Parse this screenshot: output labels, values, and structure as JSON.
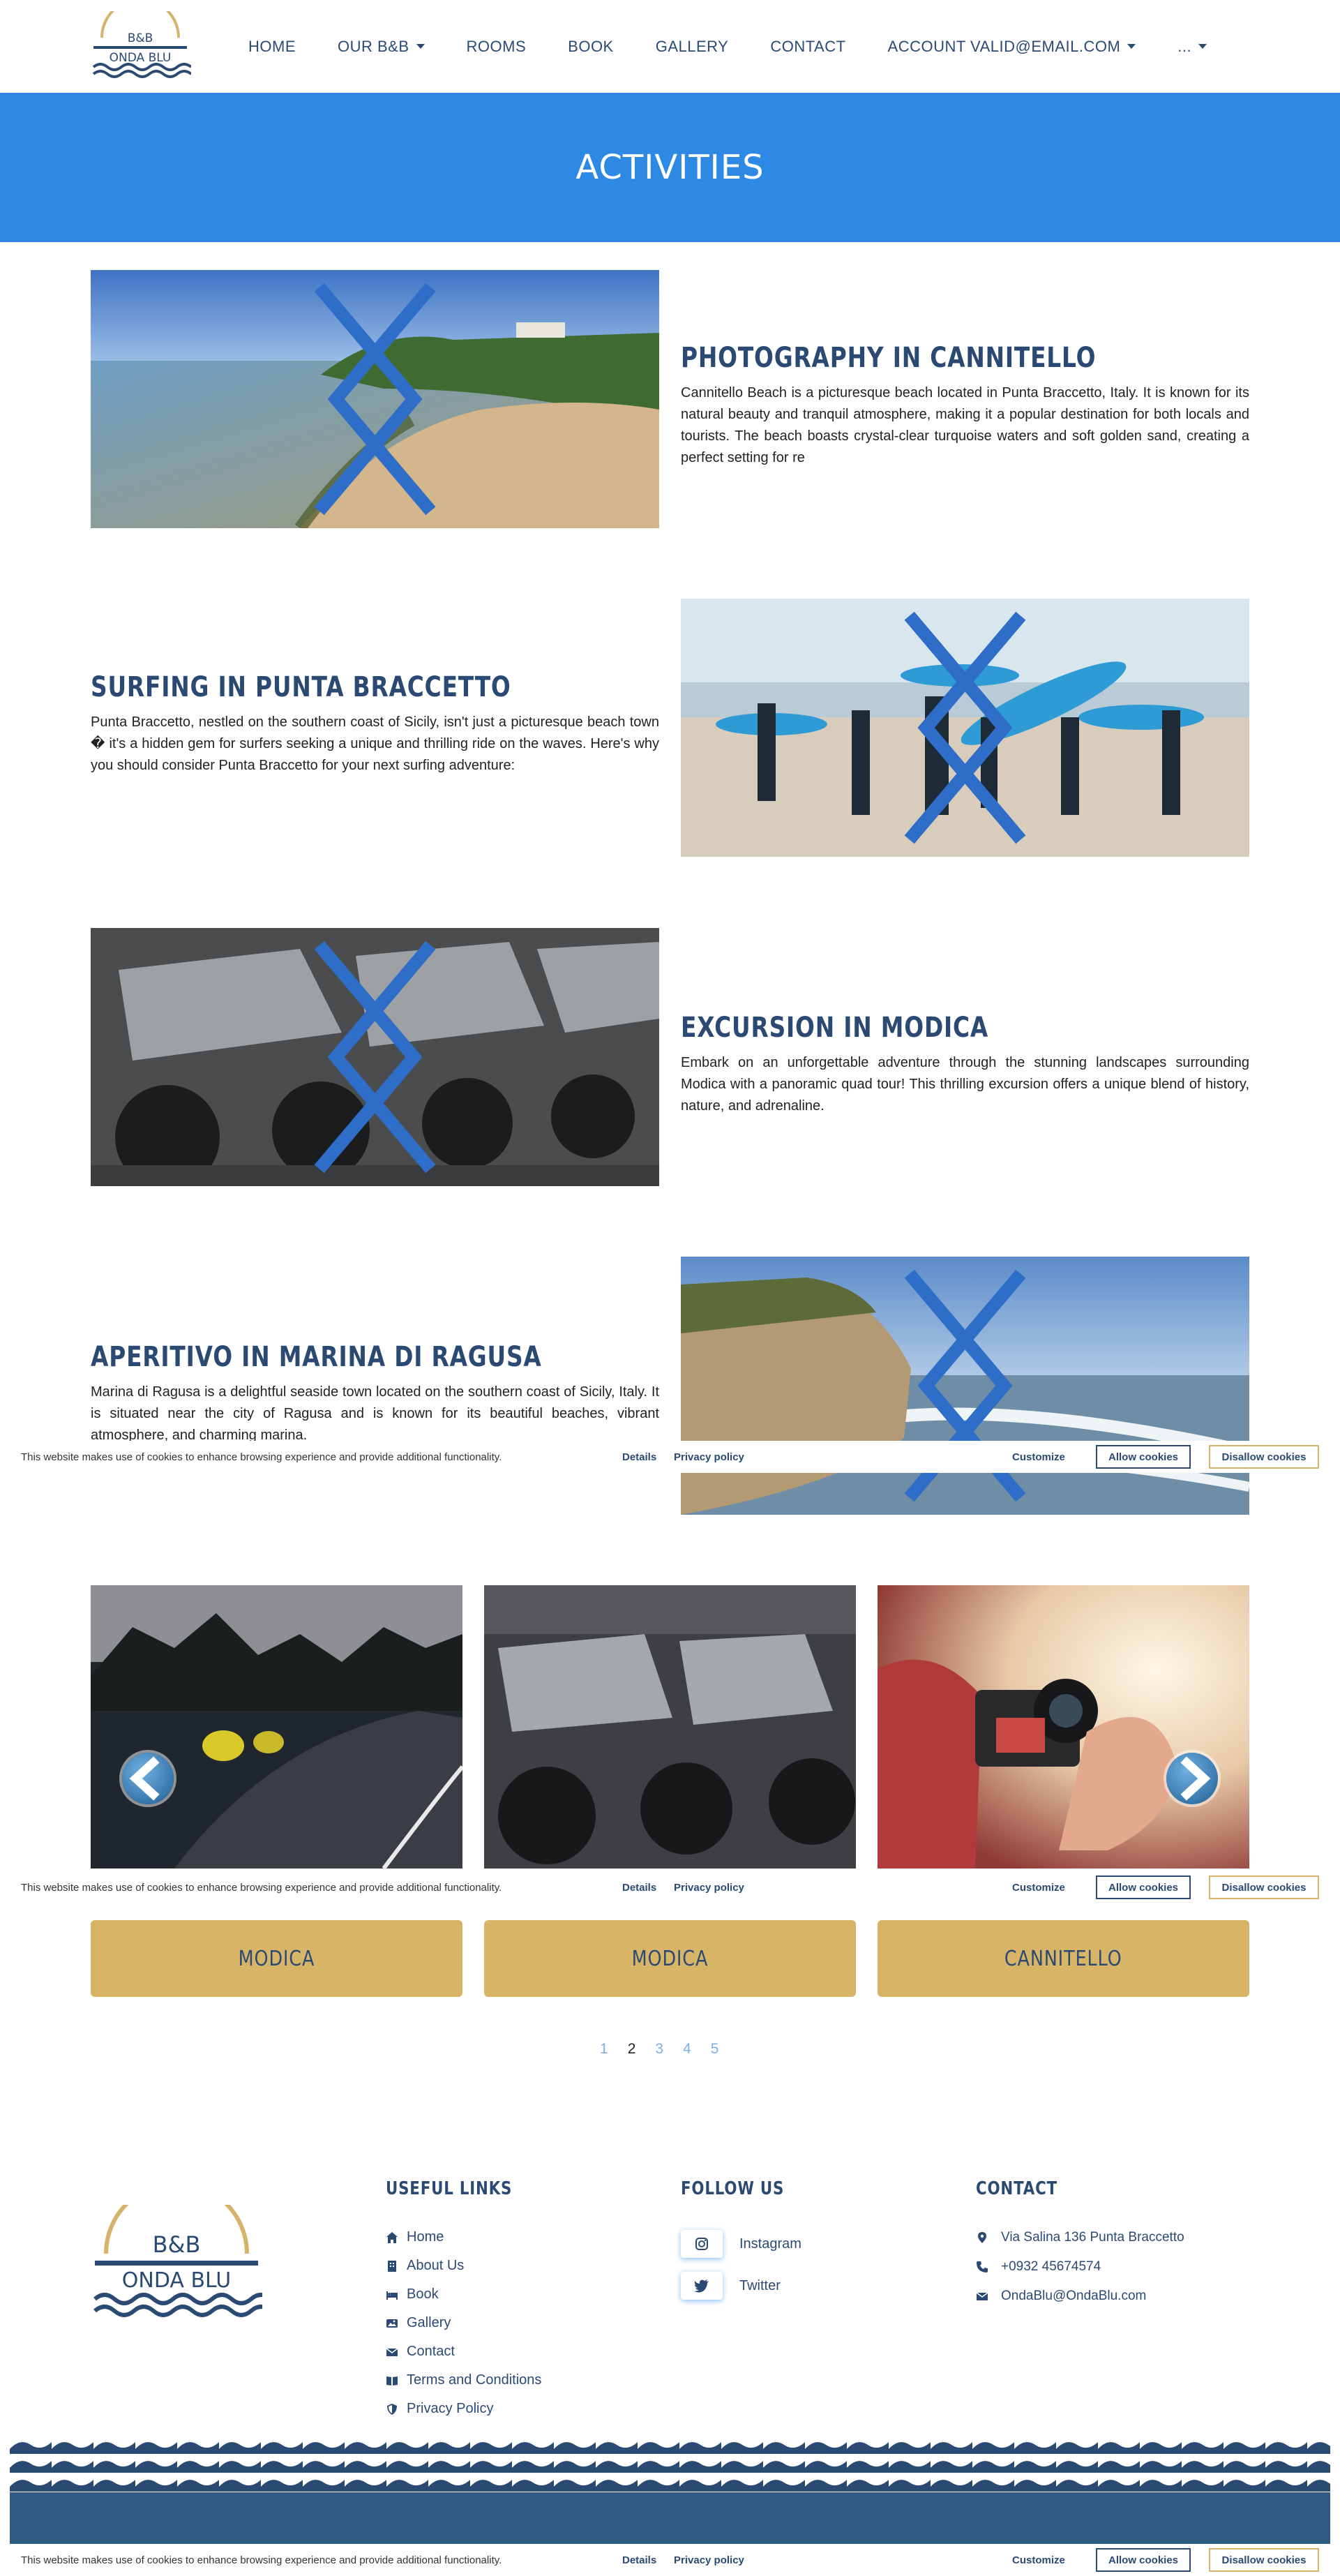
{
  "brand": {
    "logo_line1": "B&B",
    "logo_line2": "ONDA BLU"
  },
  "nav": {
    "items": [
      {
        "label": "HOME",
        "dropdown": false
      },
      {
        "label": "OUR B&B",
        "dropdown": true
      },
      {
        "label": "ROOMS",
        "dropdown": false
      },
      {
        "label": "BOOK",
        "dropdown": false
      },
      {
        "label": "GALLERY",
        "dropdown": false
      },
      {
        "label": "CONTACT",
        "dropdown": false
      },
      {
        "label": "ACCOUNT VALID@EMAIL.COM",
        "dropdown": true
      },
      {
        "label": "...",
        "dropdown": true
      }
    ]
  },
  "hero": {
    "title": "ACTIVITIES"
  },
  "activities": [
    {
      "title": "PHOTOGRAPHY IN CANNITELLO",
      "description": "Cannitello Beach is a picturesque beach located in Punta Braccetto, Italy. It is known for its natural beauty and tranquil atmosphere, making it a popular destination for both locals and tourists. The beach boasts crystal-clear turquoise waters and soft golden sand, creating a perfect setting for re",
      "image": "beach-shoreline-photo"
    },
    {
      "title": "SURFING IN PUNTA BRACCETTO",
      "description": "Punta Braccetto, nestled on the southern coast of Sicily, isn't just a picturesque beach town � it's a hidden gem for surfers seeking a unique and thrilling ride on the waves. Here's why you should consider Punta Braccetto for your next surfing adventure:",
      "image": "surfers-carrying-boards-photo"
    },
    {
      "title": "EXCURSION IN MODICA",
      "description": "Embark on an unforgettable adventure through the stunning landscapes surrounding Modica with a panoramic quad tour! This thrilling excursion offers a unique blend of history, nature, and adrenaline.",
      "image": "quad-bikes-photo"
    },
    {
      "title": "APERITIVO IN MARINA DI RAGUSA",
      "description": "Marina di Ragusa is a delightful seaside town located on the southern coast of Sicily, Italy. It is situated near the city of Ragusa and is known for its beautiful beaches, vibrant atmosphere, and charming marina.",
      "image": "coastal-cliffs-photo"
    }
  ],
  "cookie": {
    "message": "This website makes use of cookies to enhance browsing experience and provide additional functionality.",
    "details": "Details",
    "privacy": "Privacy policy",
    "customize": "Customize",
    "allow": "Allow cookies",
    "disallow": "Disallow cookies"
  },
  "gallery_cards": [
    {
      "label": "MODICA",
      "image": "quads-night-road-photo"
    },
    {
      "label": "MODICA",
      "image": "quad-bikes-row-photo"
    },
    {
      "label": "CANNITELLO",
      "image": "camera-hand-photo"
    }
  ],
  "pagination": {
    "pages": [
      "1",
      "2",
      "3",
      "4",
      "5"
    ],
    "active": "2"
  },
  "footer": {
    "useful_links": {
      "heading": "USEFUL LINKS",
      "items": [
        {
          "label": "Home",
          "icon": "home-icon"
        },
        {
          "label": "About Us",
          "icon": "building-icon"
        },
        {
          "label": "Book",
          "icon": "bed-icon"
        },
        {
          "label": "Gallery",
          "icon": "image-icon"
        },
        {
          "label": "Contact",
          "icon": "envelope-icon"
        },
        {
          "label": "Terms and Conditions",
          "icon": "book-open-icon"
        },
        {
          "label": "Privacy Policy",
          "icon": "shield-icon"
        }
      ]
    },
    "follow": {
      "heading": "FOLLOW US",
      "items": [
        {
          "label": "Instagram",
          "icon": "instagram-icon"
        },
        {
          "label": "Twitter",
          "icon": "twitter-icon"
        }
      ]
    },
    "contact": {
      "heading": "CONTACT",
      "address": "Via Salina 136 Punta Braccetto",
      "phone": "+0932 45674574",
      "email": "OndaBlu@OndaBlu.com"
    }
  },
  "colors": {
    "primary": "#2b4a73",
    "hero": "#2e89e4",
    "gold": "#d8b467",
    "footer_band": "#2f5a83"
  }
}
